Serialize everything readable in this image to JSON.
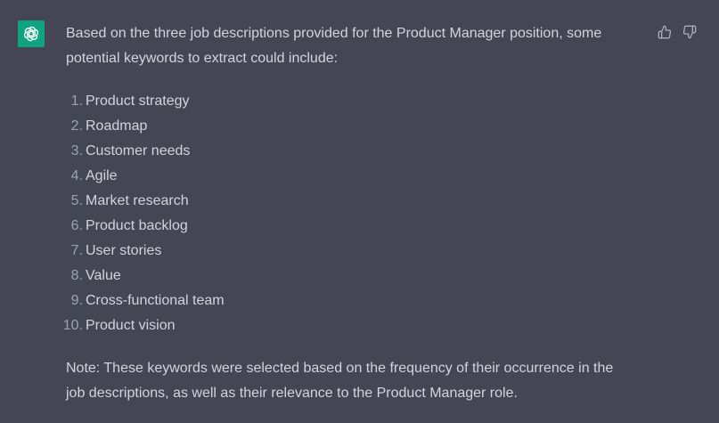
{
  "message": {
    "intro": "Based on the three job descriptions provided for the Product Manager position, some potential keywords to extract could include:",
    "keywords": [
      {
        "num": "1.",
        "text": "Product strategy"
      },
      {
        "num": "2.",
        "text": "Roadmap"
      },
      {
        "num": "3.",
        "text": "Customer needs"
      },
      {
        "num": "4.",
        "text": "Agile"
      },
      {
        "num": "5.",
        "text": "Market research"
      },
      {
        "num": "6.",
        "text": "Product backlog"
      },
      {
        "num": "7.",
        "text": "User stories"
      },
      {
        "num": "8.",
        "text": "Value"
      },
      {
        "num": "9.",
        "text": "Cross-functional team"
      },
      {
        "num": "10.",
        "text": "Product vision"
      }
    ],
    "note": "Note: These keywords were selected based on the frequency of their occurrence in the job descriptions, as well as their relevance to the Product Manager role."
  },
  "icons": {
    "avatar": "openai-logo-icon",
    "like": "thumbs-up-icon",
    "dislike": "thumbs-down-icon"
  },
  "colors": {
    "background": "#444654",
    "text": "#d1d5db",
    "list_number": "#9ca3af",
    "avatar_bg": "#10a37f"
  }
}
